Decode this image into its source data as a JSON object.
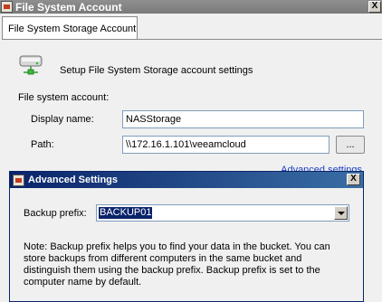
{
  "window": {
    "title": "File System Account",
    "close_glyph": "X"
  },
  "tabs": [
    {
      "label": "File System Storage Account"
    }
  ],
  "panel": {
    "header_text": "Setup File System Storage account settings",
    "group_label": "File system account:",
    "display_name_label": "Display name:",
    "display_name_value": "NASStorage",
    "path_label": "Path:",
    "path_value": "\\\\172.16.1.101\\veeamcloud",
    "browse_label": "...",
    "advanced_link": "Advanced settings"
  },
  "advanced_window": {
    "title": "Advanced Settings",
    "close_glyph": "X",
    "backup_prefix_label": "Backup prefix:",
    "backup_prefix_value": "BACKUP01",
    "note_lines": [
      "Note: Backup prefix helps you to find your data in the bucket. You can",
      "store backups from different computers in the same bucket and",
      "distinguish them using the backup prefix. Backup prefix is set to the",
      "computer name by default."
    ]
  },
  "icons": {
    "app": "app-icon",
    "storage": "hard-drive-icon"
  },
  "colors": {
    "link": "#1a3fc4",
    "active_title_start": "#0a246a",
    "active_title_end": "#3a6ea5",
    "inactive_title": "#8f8f8f"
  }
}
